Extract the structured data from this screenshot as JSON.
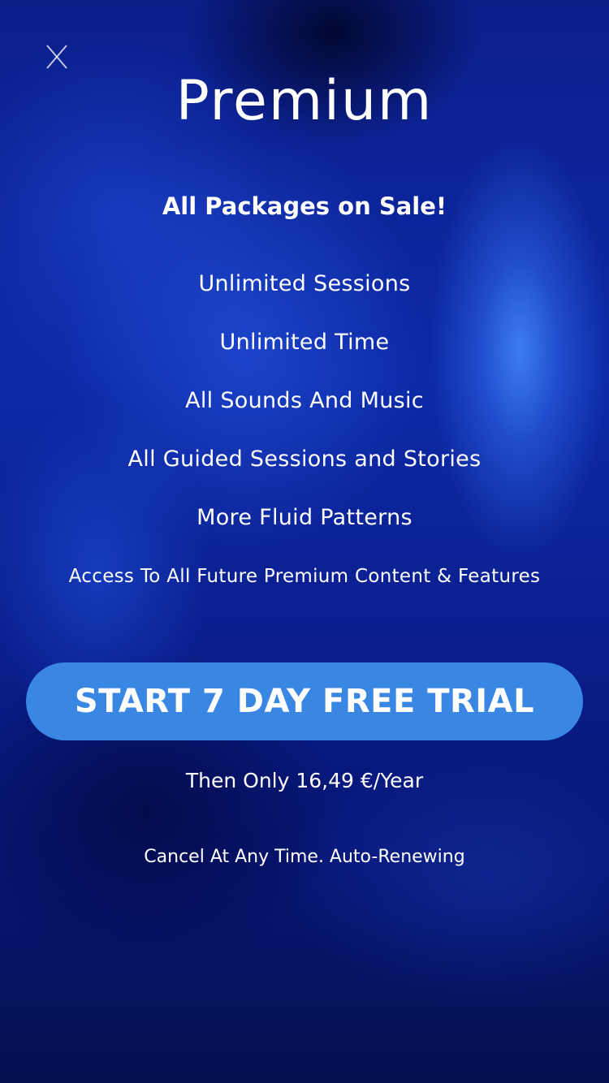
{
  "header": {
    "close_label": "X",
    "title": "Premium"
  },
  "promo": {
    "headline": "All Packages on Sale!"
  },
  "features": [
    "Unlimited Sessions",
    "Unlimited Time",
    "All Sounds And Music",
    "All Guided Sessions and Stories",
    "More Fluid Patterns",
    "Access To All Future Premium Content & Features"
  ],
  "cta": {
    "label": "START 7 DAY FREE TRIAL"
  },
  "pricing": {
    "price_text": "Then Only 16,49 €/Year",
    "terms_text": "Cancel At Any Time. Auto-Renewing"
  },
  "colors": {
    "background": "#0b1e8a",
    "accent": "#3a86e3",
    "text": "#ffffff"
  },
  "icons": {
    "close": "close-icon"
  }
}
